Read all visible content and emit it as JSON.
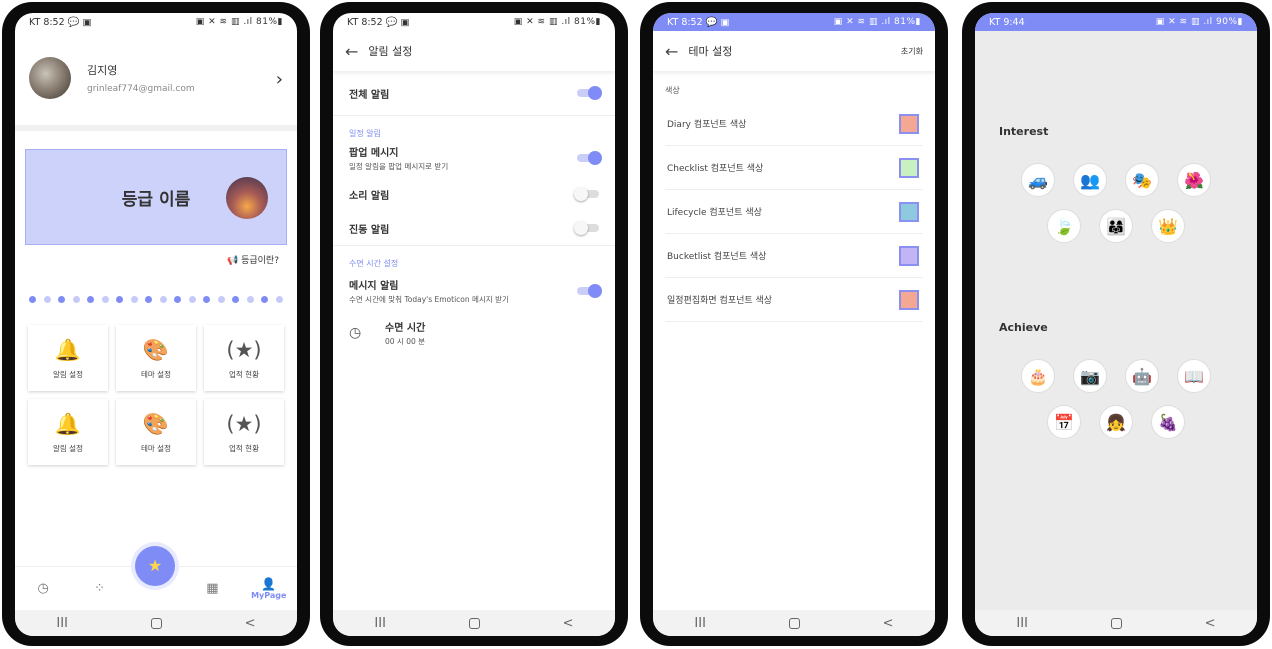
{
  "status": {
    "p1": {
      "left": "KT 8:52 💬 ▣",
      "right": "▣ ✕ ≋ ▥ .ıl 81%▮"
    },
    "p2": {
      "left": "KT 8:52 💬 ▣",
      "right": "▣ ✕ ≋ ▥ .ıl 81%▮"
    },
    "p3": {
      "left": "KT 8:52 💬 ▣",
      "right": "▣ ✕ ≋ ▥ .ıl 81%▮"
    },
    "p4": {
      "left": "KT 9:44",
      "right": "▣ ✕ ≋ ▥ .ıl 90%▮"
    }
  },
  "navbar": {
    "recents": "III",
    "back": "<"
  },
  "mypage": {
    "name": "김지영",
    "email": "grinleaf774@gmail.com",
    "grade_title": "등급 이름",
    "grade_question": "등급이란?",
    "dots_total": 18,
    "tiles": [
      {
        "icon": "bell-icon",
        "glyph": "🔔",
        "label": "알림 설정"
      },
      {
        "icon": "palette-icon",
        "glyph": "🎨",
        "label": "테마 설정"
      },
      {
        "icon": "award-icon",
        "glyph": "(★)",
        "label": "업적 현황"
      },
      {
        "icon": "bell-icon",
        "glyph": "🔔",
        "label": "알림 설정"
      },
      {
        "icon": "palette-icon",
        "glyph": "🎨",
        "label": "테마 설정"
      },
      {
        "icon": "award-icon",
        "glyph": "(★)",
        "label": "업적 현황"
      }
    ],
    "bottom_nav": {
      "mypage_label": "MyPage"
    }
  },
  "alarm": {
    "title": "알림 설정",
    "all": "전체 알림",
    "sect_schedule": "일정 알림",
    "popup": "팝업 메시지",
    "popup_sub": "일정 알림을 팝업 메시지로 받기",
    "sound": "소리 알림",
    "vibrate": "진동 알림",
    "sect_sleep": "수면 시간 설정",
    "msg": "메시지 알림",
    "msg_sub": "수면 시간에 맞춰 Today's Emoticon 메시지 받기",
    "sleep_time": "수면 시간",
    "sleep_value": "00 시 00 분"
  },
  "theme": {
    "title": "테마 설정",
    "reset": "초기화",
    "color_label": "색상",
    "rows": [
      {
        "label": "Diary 컴포넌트 색상",
        "color": "#f4a894"
      },
      {
        "label": "Checklist 컴포넌트 색상",
        "color": "#c8f0c0"
      },
      {
        "label": "Lifecycle 컴포넌트 색상",
        "color": "#8fc9e0"
      },
      {
        "label": "Bucketlist 컴포넌트 색상",
        "color": "#c3b4f5"
      },
      {
        "label": "일정편집화면 컴포넌트 색상",
        "color": "#f4a894"
      }
    ]
  },
  "achieve": {
    "interest": "Interest",
    "achieve": "Achieve",
    "interest_badges": [
      "car-icon",
      "people-icon",
      "costume-icon",
      "flower-icon",
      "leaf-icon",
      "family-icon",
      "crown-icon"
    ],
    "achieve_badges": [
      "cake-icon",
      "camera-icon",
      "robot-icon",
      "reading-icon",
      "calendar-icon",
      "girl-icon",
      "grape-icon"
    ]
  }
}
